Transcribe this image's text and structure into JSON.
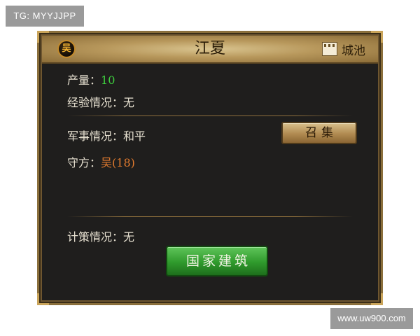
{
  "watermarks": {
    "top_left": "TG: MYYJJPP",
    "bottom_right": "www.uw900.com"
  },
  "panel": {
    "title": "江夏",
    "faction_badge": "吴",
    "city_tag": "城池",
    "city_icon": "castle-icon"
  },
  "stats": {
    "output_label": "产量：",
    "output_value": "10",
    "experience_label": "经验情况：",
    "experience_value": "无",
    "military_label": "军事情况：",
    "military_value": "和平",
    "defender_label": "守方：",
    "defender_value": "吴(18)",
    "strategy_label": "计策情况：",
    "strategy_value": "无"
  },
  "buttons": {
    "summon": "召集",
    "national_building": "国家建筑"
  },
  "colors": {
    "output_value": "#3ecf3e",
    "defender_value": "#e07a2e",
    "panel_bg": "#1f1e1d",
    "frame_gold": "#8a6f3c",
    "build_button": "#2f9a2c"
  }
}
